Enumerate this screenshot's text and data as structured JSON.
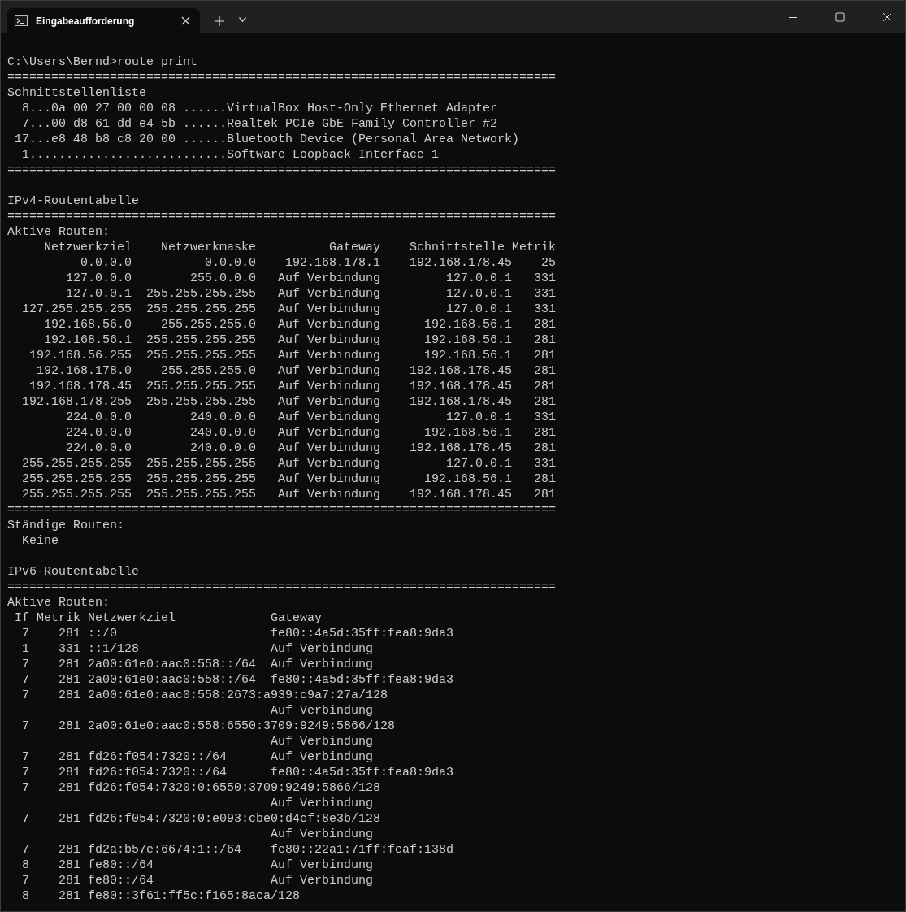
{
  "window": {
    "tab": {
      "title": "Eingabeaufforderung",
      "selected": true
    }
  },
  "blocks": [
    {
      "kind": "line",
      "text": "C:\\Users\\Bernd>route print"
    },
    {
      "kind": "rule",
      "text": "==========================================================================="
    },
    {
      "kind": "line",
      "text": "Schnittstellenliste"
    },
    {
      "kind": "interface",
      "text": "8...0a 00 27 00 00 08 ......VirtualBox Host-Only Ethernet Adapter"
    },
    {
      "kind": "interface",
      "text": "7...00 d8 61 dd e4 5b ......Realtek PCIe GbE Family Controller #2"
    },
    {
      "kind": "interface",
      "text": "17...e8 48 b8 c8 20 00 ......Bluetooth Device (Personal Area Network)"
    },
    {
      "kind": "interface",
      "text": "1...........................Software Loopback Interface 1"
    },
    {
      "kind": "rule",
      "text": "==========================================================================="
    },
    {
      "kind": "blank"
    },
    {
      "kind": "line",
      "text": "IPv4-Routentabelle"
    },
    {
      "kind": "rule",
      "text": "==========================================================================="
    },
    {
      "kind": "line",
      "text": "Aktive Routen:"
    },
    {
      "kind": "ipv4_table",
      "columns": [
        "Netzwerkziel",
        "Netzwerkmaske",
        "Gateway",
        "Schnittstelle",
        "Metrik"
      ],
      "rows": [
        [
          "0.0.0.0",
          "0.0.0.0",
          "192.168.178.1",
          "192.168.178.45",
          "25"
        ],
        [
          "127.0.0.0",
          "255.0.0.0",
          "Auf Verbindung",
          "127.0.0.1",
          "331"
        ],
        [
          "127.0.0.1",
          "255.255.255.255",
          "Auf Verbindung",
          "127.0.0.1",
          "331"
        ],
        [
          "127.255.255.255",
          "255.255.255.255",
          "Auf Verbindung",
          "127.0.0.1",
          "331"
        ],
        [
          "192.168.56.0",
          "255.255.255.0",
          "Auf Verbindung",
          "192.168.56.1",
          "281"
        ],
        [
          "192.168.56.1",
          "255.255.255.255",
          "Auf Verbindung",
          "192.168.56.1",
          "281"
        ],
        [
          "192.168.56.255",
          "255.255.255.255",
          "Auf Verbindung",
          "192.168.56.1",
          "281"
        ],
        [
          "192.168.178.0",
          "255.255.255.0",
          "Auf Verbindung",
          "192.168.178.45",
          "281"
        ],
        [
          "192.168.178.45",
          "255.255.255.255",
          "Auf Verbindung",
          "192.168.178.45",
          "281"
        ],
        [
          "192.168.178.255",
          "255.255.255.255",
          "Auf Verbindung",
          "192.168.178.45",
          "281"
        ],
        [
          "224.0.0.0",
          "240.0.0.0",
          "Auf Verbindung",
          "127.0.0.1",
          "331"
        ],
        [
          "224.0.0.0",
          "240.0.0.0",
          "Auf Verbindung",
          "192.168.56.1",
          "281"
        ],
        [
          "224.0.0.0",
          "240.0.0.0",
          "Auf Verbindung",
          "192.168.178.45",
          "281"
        ],
        [
          "255.255.255.255",
          "255.255.255.255",
          "Auf Verbindung",
          "127.0.0.1",
          "331"
        ],
        [
          "255.255.255.255",
          "255.255.255.255",
          "Auf Verbindung",
          "192.168.56.1",
          "281"
        ],
        [
          "255.255.255.255",
          "255.255.255.255",
          "Auf Verbindung",
          "192.168.178.45",
          "281"
        ]
      ]
    },
    {
      "kind": "rule",
      "text": "==========================================================================="
    },
    {
      "kind": "line",
      "text": "Ständige Routen:"
    },
    {
      "kind": "indented",
      "text": "Keine"
    },
    {
      "kind": "blank"
    },
    {
      "kind": "line",
      "text": "IPv6-Routentabelle"
    },
    {
      "kind": "rule",
      "text": "==========================================================================="
    },
    {
      "kind": "line",
      "text": "Aktive Routen:"
    },
    {
      "kind": "ipv6_table",
      "columns": [
        "If",
        "Metrik",
        "Netzwerkziel",
        "Gateway"
      ],
      "rows": [
        [
          "7",
          "281",
          "::/0",
          "fe80::4a5d:35ff:fea8:9da3"
        ],
        [
          "1",
          "331",
          "::1/128",
          "Auf Verbindung"
        ],
        [
          "7",
          "281",
          "2a00:61e0:aac0:558::/64",
          "Auf Verbindung"
        ],
        [
          "7",
          "281",
          "2a00:61e0:aac0:558::/64",
          "fe80::4a5d:35ff:fea8:9da3"
        ],
        [
          "7",
          "281",
          "2a00:61e0:aac0:558:2673:a939:c9a7:27a/128",
          "Auf Verbindung"
        ],
        [
          "7",
          "281",
          "2a00:61e0:aac0:558:6550:3709:9249:5866/128",
          "Auf Verbindung"
        ],
        [
          "7",
          "281",
          "fd26:f054:7320::/64",
          "Auf Verbindung"
        ],
        [
          "7",
          "281",
          "fd26:f054:7320::/64",
          "fe80::4a5d:35ff:fea8:9da3"
        ],
        [
          "7",
          "281",
          "fd26:f054:7320:0:6550:3709:9249:5866/128",
          "Auf Verbindung"
        ],
        [
          "7",
          "281",
          "fd26:f054:7320:0:e093:cbe0:d4cf:8e3b/128",
          "Auf Verbindung"
        ],
        [
          "7",
          "281",
          "fd2a:b57e:6674:1::/64",
          "fe80::22a1:71ff:feaf:138d"
        ],
        [
          "8",
          "281",
          "fe80::/64",
          "Auf Verbindung"
        ],
        [
          "7",
          "281",
          "fe80::/64",
          "Auf Verbindung"
        ],
        [
          "8",
          "281",
          "fe80::3f61:ff5c:f165:8aca/128"
        ]
      ]
    }
  ]
}
